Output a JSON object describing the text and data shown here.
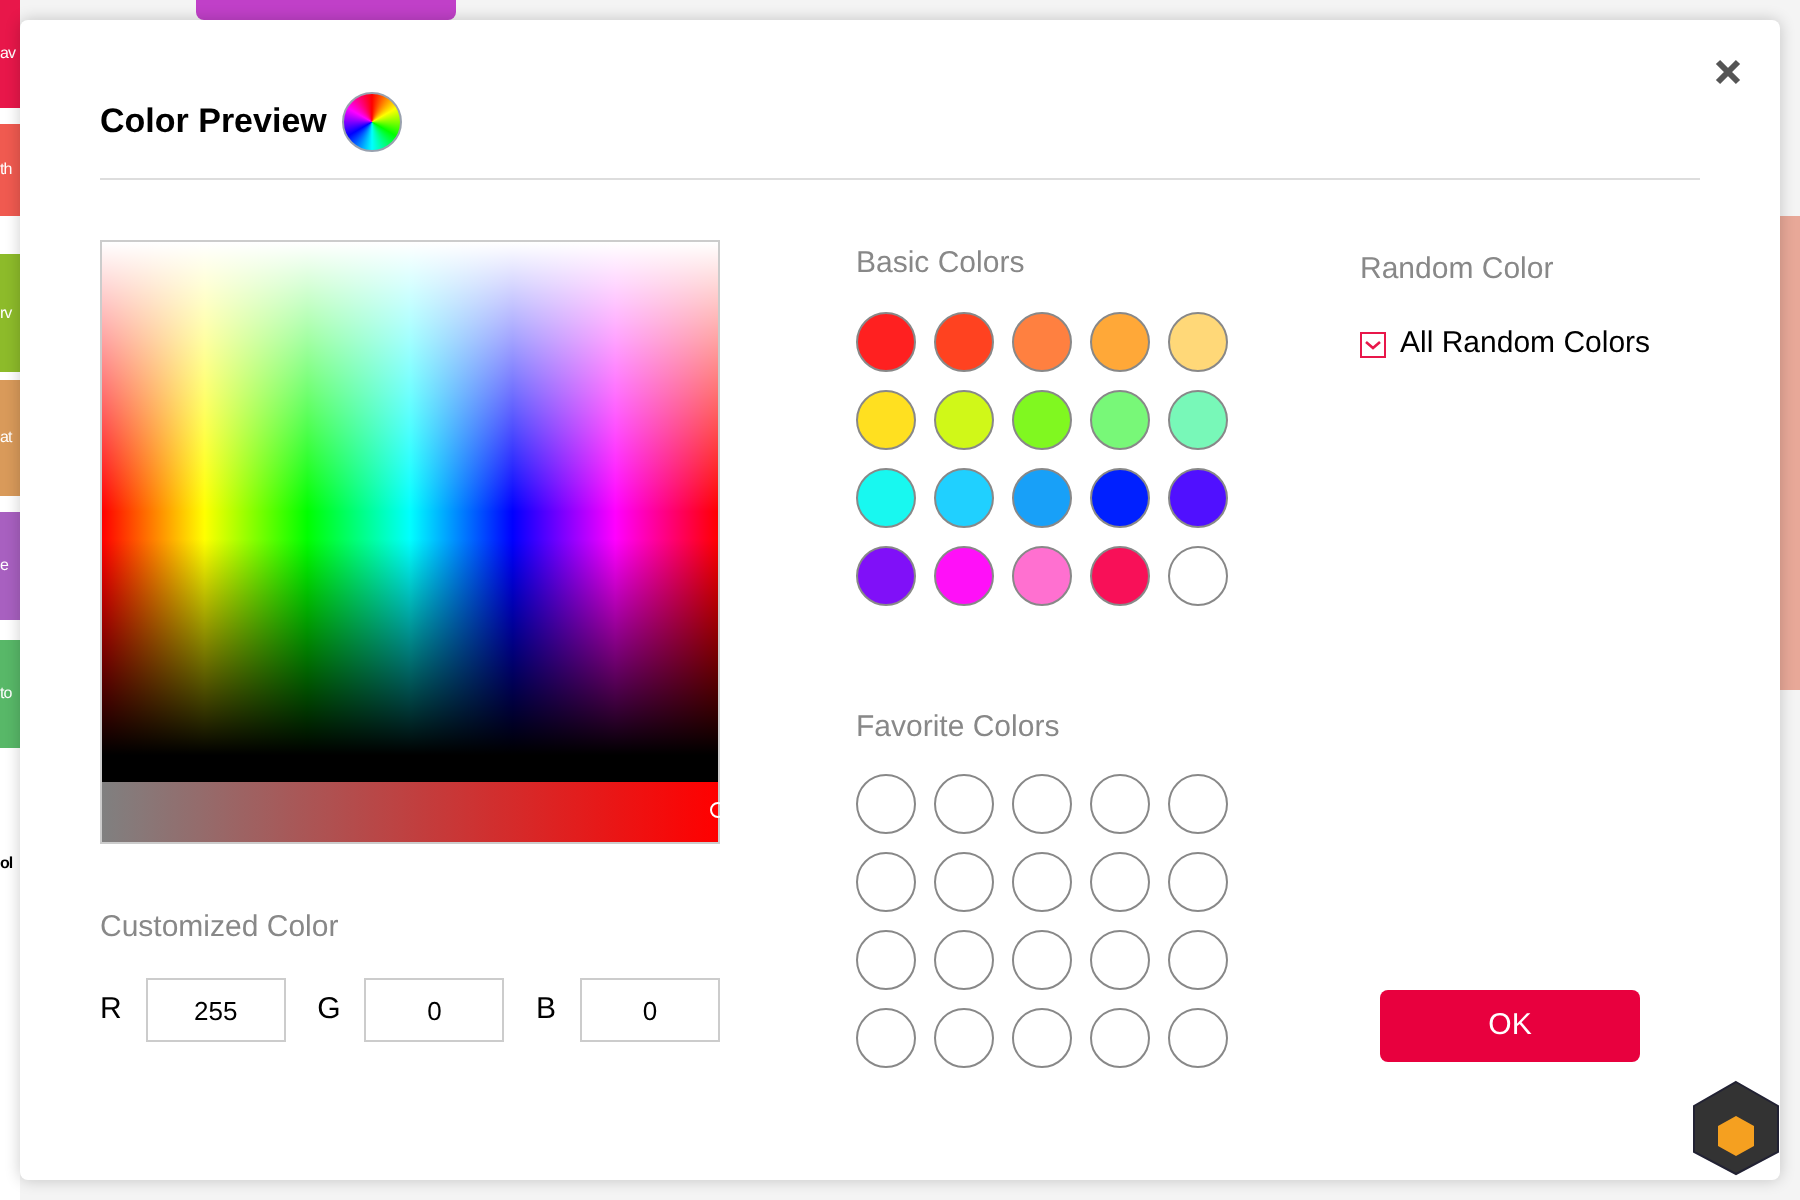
{
  "background_tabs": [
    {
      "label": "av",
      "color": "#e8174a"
    },
    {
      "label": "th",
      "color": "#f05a50"
    },
    {
      "label": "rv",
      "color": "#8dbb2a"
    },
    {
      "label": "at",
      "color": "#d99a5a"
    },
    {
      "label": "e",
      "color": "#a860c0"
    },
    {
      "label": "to",
      "color": "#58b868"
    }
  ],
  "background_label": "ol",
  "dialog": {
    "title": "Color Preview",
    "picker": {
      "slider": {
        "level": 1
      }
    },
    "customized": {
      "label": "Customized Color",
      "channels": [
        {
          "label": "R",
          "value": "255"
        },
        {
          "label": "G",
          "value": "0"
        },
        {
          "label": "B",
          "value": "0"
        }
      ]
    },
    "basic": {
      "label": "Basic Colors",
      "swatches": [
        {
          "color": "#ff2020"
        },
        {
          "color": "#ff4220"
        },
        {
          "color": "#ff8040"
        },
        {
          "color": "#ffa838"
        },
        {
          "color": "#ffd878"
        },
        {
          "color": "#ffe020"
        },
        {
          "color": "#d0f818"
        },
        {
          "color": "#80f820"
        },
        {
          "color": "#78f878"
        },
        {
          "color": "#78f8b8"
        },
        {
          "color": "#18f8f0"
        },
        {
          "color": "#20d0ff"
        },
        {
          "color": "#18a0f8"
        },
        {
          "color": "#0020ff"
        },
        {
          "color": "#5010ff"
        },
        {
          "color": "#8010f8"
        },
        {
          "color": "#ff10f8"
        },
        {
          "color": "#ff70d0"
        },
        {
          "color": "#f81058"
        },
        {
          "color": "#ffffff"
        }
      ]
    },
    "favorite": {
      "label": "Favorite Colors"
    },
    "random": {
      "label": "Random Color",
      "option": {
        "label": "All Random Colors",
        "checked": true
      }
    },
    "ok_button": "OK"
  }
}
